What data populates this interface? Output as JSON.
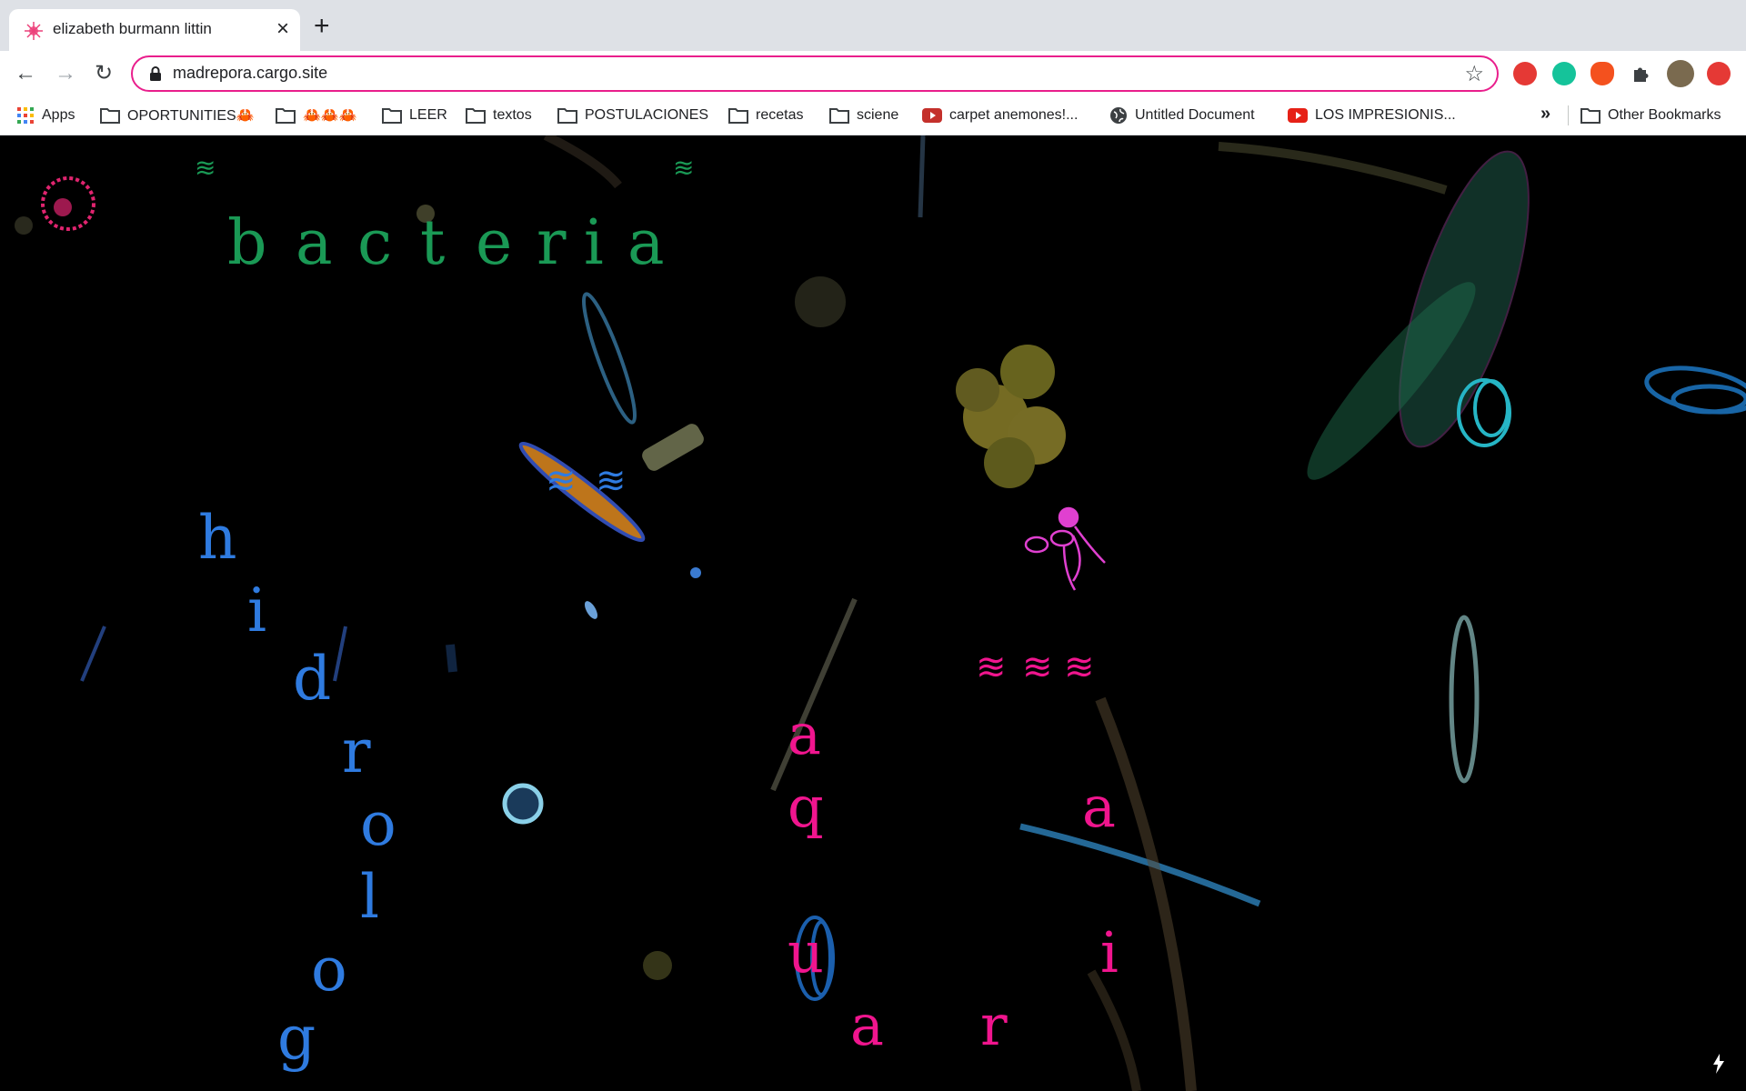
{
  "browser": {
    "tab": {
      "title": "elizabeth burmann littin"
    },
    "new_tab_label": "+",
    "address": {
      "url": "madrepora.cargo.site"
    },
    "bookmarks": [
      {
        "label": "Apps",
        "icon": "apps-grid-icon"
      },
      {
        "label": "OPORTUNITIES🦀",
        "icon": "folder-icon"
      },
      {
        "label": "🦀🦀🦀",
        "icon": "folder-icon"
      },
      {
        "label": "LEER",
        "icon": "folder-icon"
      },
      {
        "label": "textos",
        "icon": "folder-icon"
      },
      {
        "label": "POSTULACIONES",
        "icon": "folder-icon"
      },
      {
        "label": "recetas",
        "icon": "folder-icon"
      },
      {
        "label": "sciene",
        "icon": "folder-icon"
      },
      {
        "label": "carpet anemones!...",
        "icon": "youtube-icon"
      },
      {
        "label": "Untitled Document",
        "icon": "globe-icon"
      },
      {
        "label": "LOS IMPRESIONIS...",
        "icon": "youtube-icon"
      }
    ],
    "more_bookmarks": "»",
    "other_bookmarks": "Other Bookmarks"
  },
  "page": {
    "title_word": [
      "b",
      "a",
      "c",
      "t",
      "e",
      "r",
      "i",
      "a"
    ],
    "hidrologia_letters": [
      "h",
      "i",
      "d",
      "r",
      "o",
      "l",
      "o",
      "g"
    ],
    "aquarium_letters": [
      "a",
      "q",
      "a",
      "u",
      "i",
      "a",
      "r"
    ],
    "wave_symbol": "≋",
    "small_wave_symbol": "≋",
    "colors": {
      "green": "#1a9955",
      "blue": "#2f7be0",
      "pink": "#f0158e",
      "accent_border": "#e91e8c"
    }
  }
}
